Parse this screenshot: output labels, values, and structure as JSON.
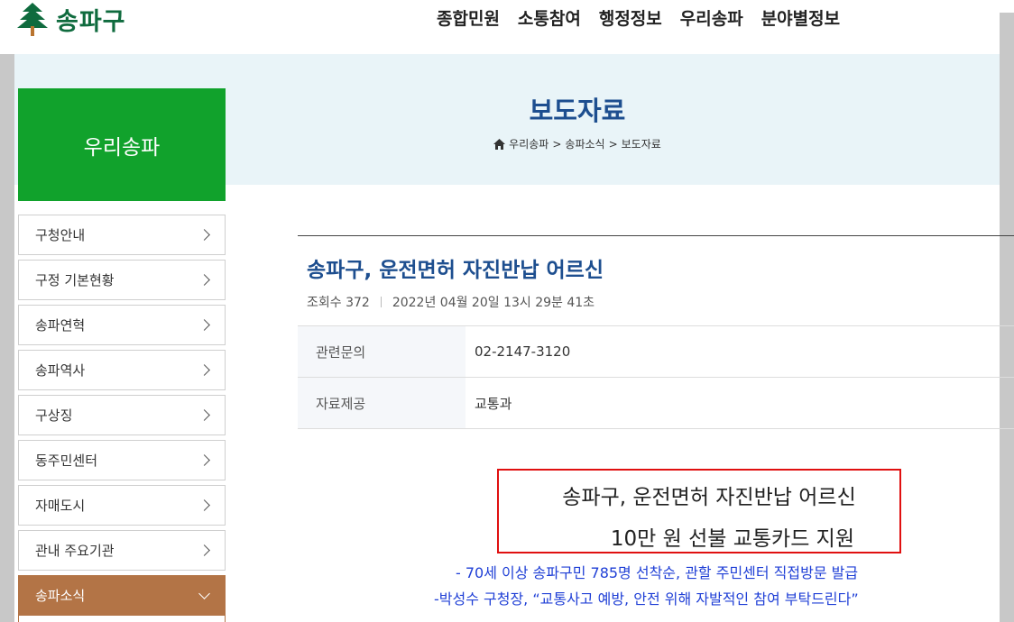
{
  "header": {
    "logo_text": "송파구",
    "nav": [
      "종합민원",
      "소통참여",
      "행정정보",
      "우리송파",
      "분야별정보"
    ]
  },
  "page": {
    "title": "보도자료",
    "breadcrumb": [
      "우리송파",
      "송파소식",
      "보도자료"
    ]
  },
  "sidebar": {
    "heading": "우리송파",
    "items": [
      {
        "label": "구청안내"
      },
      {
        "label": "구정 기본현황"
      },
      {
        "label": "송파연혁"
      },
      {
        "label": "송파역사"
      },
      {
        "label": "구상징"
      },
      {
        "label": "동주민센터"
      },
      {
        "label": "자매도시"
      },
      {
        "label": "관내 주요기관"
      },
      {
        "label": "송파소식"
      }
    ]
  },
  "article": {
    "title": "송파구, 운전면허 자진반납 어르신",
    "views_label": "조회수",
    "views": "372",
    "datetime": "2022년 04월 20일 13시 29분 41초",
    "info": [
      {
        "label": "관련문의",
        "value": "02-2147-3120"
      },
      {
        "label": "자료제공",
        "value": "교통과"
      }
    ],
    "headline_line1": "송파구, 운전면허 자진반납 어르신",
    "headline_line2": "10만 원 선불 교통카드 지원",
    "sub_line1": "- 70세 이상 송파구민 785명 선착순, 관할 주민센터 직접방문 발급",
    "sub_line2": "-박성수 구청장, “교통사고 예방, 안전 위해 자발적인 참여 부탁드린다”"
  },
  "colors": {
    "brand_green": "#11a22c",
    "title_blue": "#1d4e8f",
    "active_brown": "#b37446",
    "highlight_red": "#e01010",
    "sub_blue": "#1f3fd6"
  }
}
